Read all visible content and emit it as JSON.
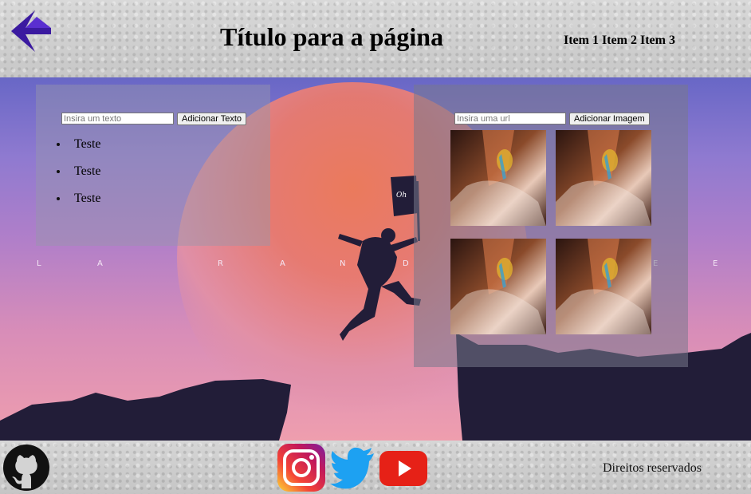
{
  "header": {
    "title": "Título para a página",
    "nav": [
      "Item 1",
      "Item 2",
      "Item 3"
    ],
    "logo_icon": "paper-plane-icon"
  },
  "scene": {
    "letters": [
      "L",
      "A",
      "R",
      "A",
      "N",
      "D",
      "E",
      "E"
    ]
  },
  "text_panel": {
    "input_placeholder": "Insira um texto",
    "input_value": "",
    "button_label": "Adicionar Texto",
    "items": [
      "Teste",
      "Teste",
      "Teste"
    ]
  },
  "image_panel": {
    "input_placeholder": "Insira uma url",
    "input_value": "",
    "button_label": "Adicionar Imagem",
    "image_count": 4
  },
  "footer": {
    "icons": [
      "github-icon",
      "instagram-icon",
      "twitter-icon",
      "youtube-icon"
    ],
    "rights_text": "Direitos reservados"
  },
  "colors": {
    "logo": "#3b1aa0",
    "sky_top": "#6867c6",
    "sky_bottom": "#ef9eae",
    "mountain": "#221d38",
    "twitter": "#1da1f2",
    "youtube": "#e62117"
  }
}
